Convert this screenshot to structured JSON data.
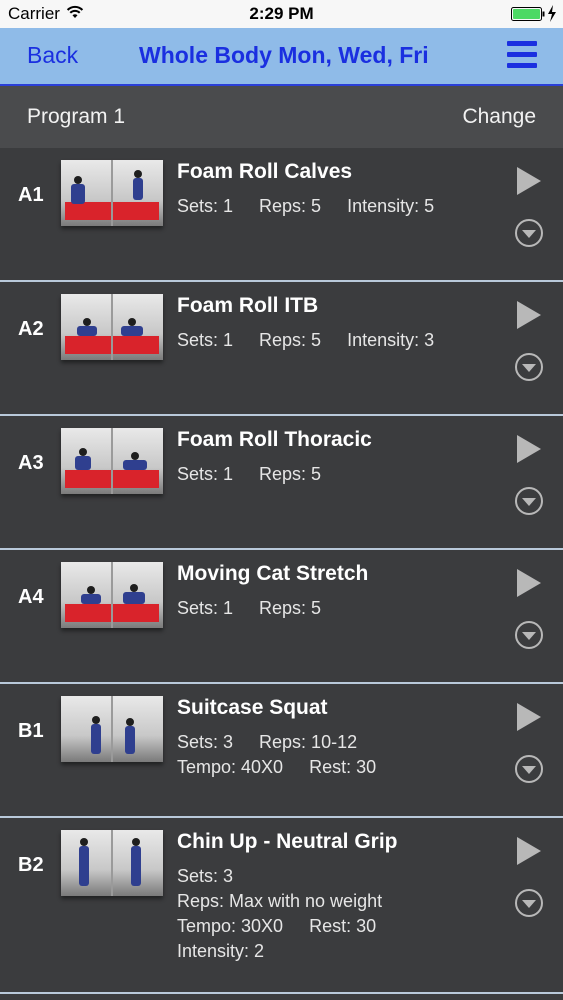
{
  "status_bar": {
    "carrier": "Carrier",
    "time": "2:29 PM",
    "battery_color": "#4cd964"
  },
  "nav": {
    "back_label": "Back",
    "title": "Whole Body Mon, Wed, Fri",
    "menu_icon": "hamburger-menu-icon",
    "accent_color": "#1a2fe0",
    "bar_color": "#8fbbe8"
  },
  "program": {
    "name": "Program 1",
    "change_label": "Change"
  },
  "exercises": [
    {
      "code": "A1",
      "name": "Foam Roll Calves",
      "lines": [
        [
          "Sets: 1",
          "Reps: 5",
          "Intensity: 5"
        ]
      ]
    },
    {
      "code": "A2",
      "name": "Foam Roll ITB",
      "lines": [
        [
          "Sets: 1",
          "Reps: 5",
          "Intensity: 3"
        ]
      ]
    },
    {
      "code": "A3",
      "name": "Foam Roll Thoracic",
      "lines": [
        [
          "Sets: 1",
          "Reps: 5"
        ]
      ]
    },
    {
      "code": "A4",
      "name": "Moving Cat Stretch",
      "lines": [
        [
          "Sets: 1",
          "Reps: 5"
        ]
      ]
    },
    {
      "code": "B1",
      "name": "Suitcase Squat",
      "lines": [
        [
          "Sets: 3",
          "Reps: 10-12"
        ],
        [
          "Tempo: 40X0",
          "Rest: 30"
        ]
      ]
    },
    {
      "code": "B2",
      "name": "Chin Up - Neutral Grip",
      "lines": [
        [
          "Sets: 3"
        ],
        [
          "Reps: Max with no weight"
        ],
        [
          "Tempo: 30X0",
          "Rest: 30"
        ],
        [
          "Intensity: 2"
        ]
      ]
    }
  ]
}
